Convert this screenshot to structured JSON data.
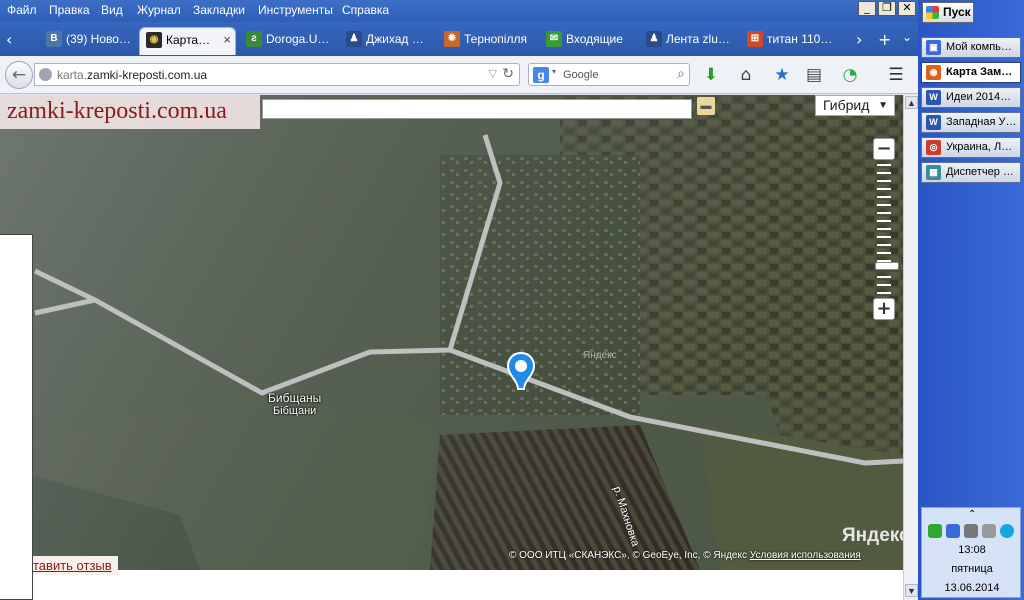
{
  "menubar": {
    "items": [
      {
        "label": "Файл"
      },
      {
        "label": "Правка"
      },
      {
        "label": "Вид"
      },
      {
        "label": "Журнал"
      },
      {
        "label": "Закладки"
      },
      {
        "label": "Инструменты"
      },
      {
        "label": "Справка"
      }
    ],
    "window_controls": {
      "minimize": "_",
      "restore": "❐",
      "close": "✕"
    }
  },
  "tabs": [
    {
      "label": "(39) Ново…",
      "icon": "vk-icon",
      "icon_text": "В",
      "icon_color": "#4a76a8"
    },
    {
      "label": "Карта…",
      "icon": "castle-icon",
      "icon_text": "◉",
      "icon_color": "#2b2b2b",
      "active": true
    },
    {
      "label": "Doroga.U…",
      "icon": "road-icon",
      "icon_text": "ƨ",
      "icon_color": "#3a8a3a"
    },
    {
      "label": "Джихад …",
      "icon": "user-icon",
      "icon_text": "♟",
      "icon_color": "#2a4a8a"
    },
    {
      "label": "Тернопілля",
      "icon": "map-icon",
      "icon_text": "✹",
      "icon_color": "#c66a2a"
    },
    {
      "label": "Входящие",
      "icon": "mail-icon",
      "icon_text": "✉",
      "icon_color": "#3a9a3a"
    },
    {
      "label": "Лента zlu…",
      "icon": "user-icon",
      "icon_text": "♟",
      "icon_color": "#2a4a8a"
    },
    {
      "label": "титан 110…",
      "icon": "windows-icon",
      "icon_text": "⊞",
      "icon_color": "#d04a2a"
    }
  ],
  "tabbar_controls": {
    "scroll_left": "‹",
    "scroll_right": "›",
    "new_tab": "+",
    "list_all": "⌄"
  },
  "navbar": {
    "back": "←",
    "url_prefix": "karta.",
    "url_host": "zamki-kreposti.com.ua",
    "url_dropdown": "▽",
    "reload": "↻",
    "search_engine_letter": "g",
    "search_placeholder": "Google",
    "search_icon": "⌕",
    "toolbar_icons": [
      {
        "name": "download-icon",
        "glyph": "⬇",
        "color": "#2e9a2e"
      },
      {
        "name": "home-icon",
        "glyph": "⌂",
        "color": "#444"
      },
      {
        "name": "bookmark-star-icon",
        "glyph": "★",
        "color": "#2b6cd1"
      },
      {
        "name": "bookmarks-list-icon",
        "glyph": "▤",
        "color": "#444"
      },
      {
        "name": "sync-icon",
        "glyph": "◔",
        "color": "#2eaa4a"
      },
      {
        "name": "menu-icon",
        "glyph": "☰",
        "color": "#333"
      }
    ]
  },
  "page": {
    "logo": "zamki-kreposti.com.ua",
    "map_search_value": "",
    "ruler": "📏",
    "layer_select": "Гибрид",
    "layer_arrow": "▼",
    "zoom_out": "−",
    "zoom_in": "+",
    "zoom_level_fraction": 0.8,
    "place_name_ru": "Бибщаны",
    "place_name_uk": "Бібщани",
    "river_label": "р. Махновка",
    "watermark_small": "Яндекс",
    "watermark_big": "Яндекс",
    "attribution": "© ООО ИТЦ «СКАНЭКС», © GeoEye, Inc, © Яндекс",
    "terms_link": "Условия использования",
    "feedback_link": "тавить отзыв"
  },
  "scrollbar": {
    "up": "▲",
    "down": "▼"
  },
  "taskbar": {
    "start": "Пуск",
    "items": [
      {
        "label": "Мой компь…",
        "icon": "computer-icon",
        "icon_text": "▣",
        "icon_color": "#3a6ad8"
      },
      {
        "label": "Карта Зам…",
        "icon": "firefox-icon",
        "icon_text": "◉",
        "icon_color": "#e0601a",
        "active": true
      },
      {
        "label": "Идеи 2014…",
        "icon": "word-icon",
        "icon_text": "W",
        "icon_color": "#2a56b0"
      },
      {
        "label": "Западная У…",
        "icon": "word-icon",
        "icon_text": "W",
        "icon_color": "#2a56b0"
      },
      {
        "label": "Украина, Л…",
        "icon": "chrome-icon",
        "icon_text": "◎",
        "icon_color": "#d23a2a"
      },
      {
        "label": "Диспетчер …",
        "icon": "task-manager-icon",
        "icon_text": "▦",
        "icon_color": "#3a8a9a"
      }
    ],
    "tray": {
      "expand": "⌃",
      "time": "13:08",
      "day": "пятница",
      "date": "13.06.2014",
      "icons": [
        {
          "name": "green-tray-icon",
          "color": "#2ea82e"
        },
        {
          "name": "network-tray-icon",
          "color": "#3a6ad8"
        },
        {
          "name": "speaker-tray-icon",
          "color": "#777"
        },
        {
          "name": "usb-tray-icon",
          "color": "#999"
        },
        {
          "name": "skype-tray-icon",
          "color": "#16a6e0"
        }
      ]
    }
  }
}
